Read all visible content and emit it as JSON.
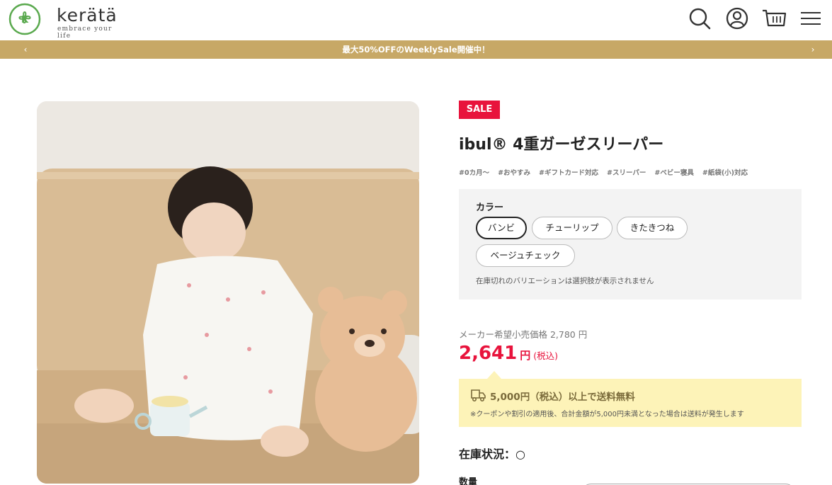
{
  "header": {
    "logo_text": "kerätä",
    "logo_tagline": "embrace your life",
    "icons": [
      "search-icon",
      "account-icon",
      "cart-icon",
      "menu-icon"
    ]
  },
  "announcement": {
    "text": "最大50%OFFのWeeklySale開催中！",
    "prev_arrow": "‹",
    "next_arrow": "›"
  },
  "product": {
    "badge": "SALE",
    "title": "ibul® 4重ガーゼスリーパー",
    "tags": [
      "#0カ月〜",
      "#おやすみ",
      "#ギフトカード対応",
      "#スリーパー",
      "#ベビー寝具",
      "#紙袋(小)対応"
    ],
    "variant": {
      "label": "カラー",
      "options": [
        "バンビ",
        "チューリップ",
        "きたきつね",
        "ベージュチェック"
      ],
      "selected": "バンビ",
      "note": "在庫切れのバリエーションは選択肢が表示されません"
    },
    "msrp_text": "メーカー希望小売価格 2,780 円",
    "price": "2,641",
    "price_unit": "円",
    "price_tax": "(税込)",
    "shipping_main": "5,000円（税込）以上で送料無料",
    "shipping_note": "※クーポンや割引の適用後、合計金額が5,000円未満となった場合は送料が発生します",
    "stock_label": "在庫状況：",
    "stock_value": "○",
    "quantity_label": "数量"
  },
  "colors": {
    "accent_gold": "#c7a866",
    "sale_red": "#e8133c",
    "logo_green": "#5aa94e",
    "shipping_bg": "#fdf3b8"
  }
}
